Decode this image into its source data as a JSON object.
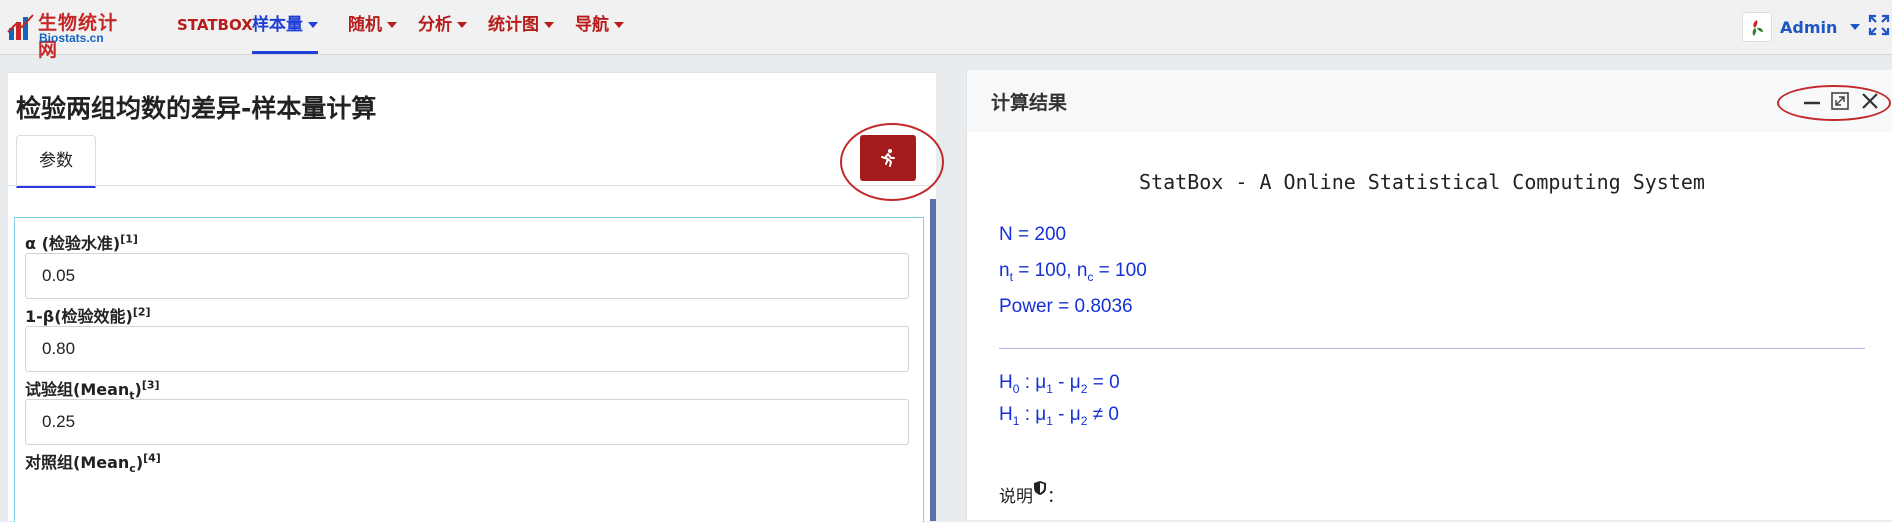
{
  "brand": {
    "name_cn": "生物统计网",
    "name_en": "Biostats.cn"
  },
  "nav": {
    "statbox": "STATBOX",
    "sample_size": "样本量",
    "random": "随机",
    "analysis": "分析",
    "charts": "统计图",
    "navigation": "导航"
  },
  "user": {
    "name": "Admin"
  },
  "page": {
    "title": "检验两组均数的差异-样本量计算",
    "tab_params": "参数"
  },
  "form": {
    "alpha": {
      "label": "α (检验水准)",
      "ref": "[1]",
      "value": "0.05"
    },
    "power": {
      "label": "1-β(检验效能)",
      "ref": "[2]",
      "value": "0.80"
    },
    "mean_t": {
      "label": "试验组(Mean",
      "sub": "t",
      "close": ")",
      "ref": "[3]",
      "value": "0.25"
    },
    "mean_c": {
      "label": "对照组(Mean",
      "sub": "c",
      "close": ")",
      "ref": "[4]"
    }
  },
  "results": {
    "panel_title": "计算结果",
    "system_title": "StatBox - A Online Statistical Computing System",
    "n_total": "N = 200",
    "n_t_prefix": "n",
    "n_t_sub": "t",
    "n_t_value": " = 100, n",
    "n_c_sub": "c",
    "n_c_value": " = 100",
    "power": "Power = 0.8036",
    "h0": {
      "h": "H",
      "hsub": "0",
      "mu1": " : μ",
      "mu1sub": "1",
      "mu2": " - μ",
      "mu2sub": "2",
      "rel": " = 0"
    },
    "h1": {
      "h": "H",
      "hsub": "1",
      "mu1": " : μ",
      "mu1sub": "1",
      "mu2": " - μ",
      "mu2sub": "2",
      "rel": " ≠ 0"
    },
    "explain_label": "说明",
    "explain_colon": "："
  },
  "colors": {
    "brand_red": "#a31b1b",
    "result_blue": "#1631d6",
    "active_nav": "#1e3fd6"
  }
}
